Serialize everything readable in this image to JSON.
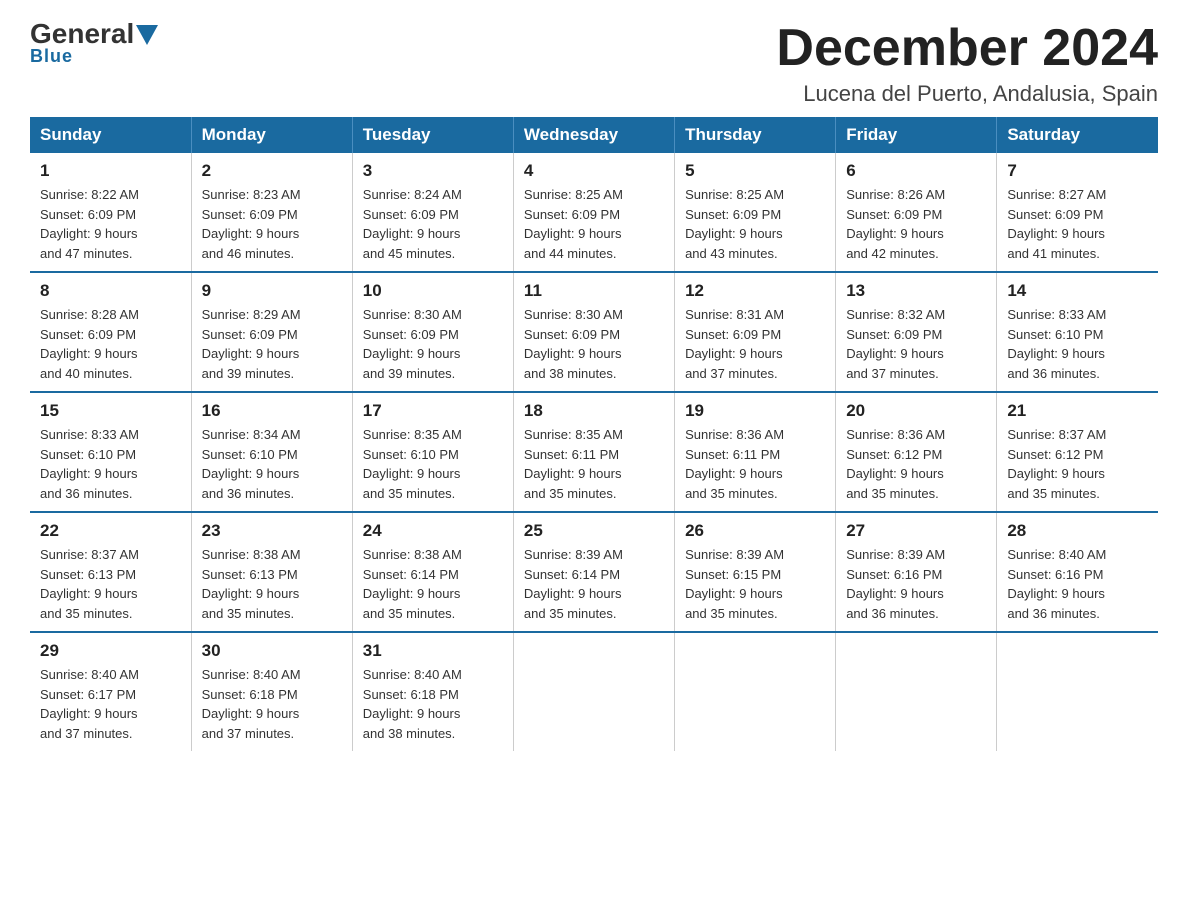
{
  "header": {
    "logo": {
      "general": "General",
      "blue": "Blue",
      "arrow_color": "#1a6aa0"
    },
    "title": "December 2024",
    "location": "Lucena del Puerto, Andalusia, Spain"
  },
  "days_of_week": [
    "Sunday",
    "Monday",
    "Tuesday",
    "Wednesday",
    "Thursday",
    "Friday",
    "Saturday"
  ],
  "weeks": [
    [
      {
        "num": "1",
        "sunrise": "8:22 AM",
        "sunset": "6:09 PM",
        "daylight": "9 hours and 47 minutes."
      },
      {
        "num": "2",
        "sunrise": "8:23 AM",
        "sunset": "6:09 PM",
        "daylight": "9 hours and 46 minutes."
      },
      {
        "num": "3",
        "sunrise": "8:24 AM",
        "sunset": "6:09 PM",
        "daylight": "9 hours and 45 minutes."
      },
      {
        "num": "4",
        "sunrise": "8:25 AM",
        "sunset": "6:09 PM",
        "daylight": "9 hours and 44 minutes."
      },
      {
        "num": "5",
        "sunrise": "8:25 AM",
        "sunset": "6:09 PM",
        "daylight": "9 hours and 43 minutes."
      },
      {
        "num": "6",
        "sunrise": "8:26 AM",
        "sunset": "6:09 PM",
        "daylight": "9 hours and 42 minutes."
      },
      {
        "num": "7",
        "sunrise": "8:27 AM",
        "sunset": "6:09 PM",
        "daylight": "9 hours and 41 minutes."
      }
    ],
    [
      {
        "num": "8",
        "sunrise": "8:28 AM",
        "sunset": "6:09 PM",
        "daylight": "9 hours and 40 minutes."
      },
      {
        "num": "9",
        "sunrise": "8:29 AM",
        "sunset": "6:09 PM",
        "daylight": "9 hours and 39 minutes."
      },
      {
        "num": "10",
        "sunrise": "8:30 AM",
        "sunset": "6:09 PM",
        "daylight": "9 hours and 39 minutes."
      },
      {
        "num": "11",
        "sunrise": "8:30 AM",
        "sunset": "6:09 PM",
        "daylight": "9 hours and 38 minutes."
      },
      {
        "num": "12",
        "sunrise": "8:31 AM",
        "sunset": "6:09 PM",
        "daylight": "9 hours and 37 minutes."
      },
      {
        "num": "13",
        "sunrise": "8:32 AM",
        "sunset": "6:09 PM",
        "daylight": "9 hours and 37 minutes."
      },
      {
        "num": "14",
        "sunrise": "8:33 AM",
        "sunset": "6:10 PM",
        "daylight": "9 hours and 36 minutes."
      }
    ],
    [
      {
        "num": "15",
        "sunrise": "8:33 AM",
        "sunset": "6:10 PM",
        "daylight": "9 hours and 36 minutes."
      },
      {
        "num": "16",
        "sunrise": "8:34 AM",
        "sunset": "6:10 PM",
        "daylight": "9 hours and 36 minutes."
      },
      {
        "num": "17",
        "sunrise": "8:35 AM",
        "sunset": "6:10 PM",
        "daylight": "9 hours and 35 minutes."
      },
      {
        "num": "18",
        "sunrise": "8:35 AM",
        "sunset": "6:11 PM",
        "daylight": "9 hours and 35 minutes."
      },
      {
        "num": "19",
        "sunrise": "8:36 AM",
        "sunset": "6:11 PM",
        "daylight": "9 hours and 35 minutes."
      },
      {
        "num": "20",
        "sunrise": "8:36 AM",
        "sunset": "6:12 PM",
        "daylight": "9 hours and 35 minutes."
      },
      {
        "num": "21",
        "sunrise": "8:37 AM",
        "sunset": "6:12 PM",
        "daylight": "9 hours and 35 minutes."
      }
    ],
    [
      {
        "num": "22",
        "sunrise": "8:37 AM",
        "sunset": "6:13 PM",
        "daylight": "9 hours and 35 minutes."
      },
      {
        "num": "23",
        "sunrise": "8:38 AM",
        "sunset": "6:13 PM",
        "daylight": "9 hours and 35 minutes."
      },
      {
        "num": "24",
        "sunrise": "8:38 AM",
        "sunset": "6:14 PM",
        "daylight": "9 hours and 35 minutes."
      },
      {
        "num": "25",
        "sunrise": "8:39 AM",
        "sunset": "6:14 PM",
        "daylight": "9 hours and 35 minutes."
      },
      {
        "num": "26",
        "sunrise": "8:39 AM",
        "sunset": "6:15 PM",
        "daylight": "9 hours and 35 minutes."
      },
      {
        "num": "27",
        "sunrise": "8:39 AM",
        "sunset": "6:16 PM",
        "daylight": "9 hours and 36 minutes."
      },
      {
        "num": "28",
        "sunrise": "8:40 AM",
        "sunset": "6:16 PM",
        "daylight": "9 hours and 36 minutes."
      }
    ],
    [
      {
        "num": "29",
        "sunrise": "8:40 AM",
        "sunset": "6:17 PM",
        "daylight": "9 hours and 37 minutes."
      },
      {
        "num": "30",
        "sunrise": "8:40 AM",
        "sunset": "6:18 PM",
        "daylight": "9 hours and 37 minutes."
      },
      {
        "num": "31",
        "sunrise": "8:40 AM",
        "sunset": "6:18 PM",
        "daylight": "9 hours and 38 minutes."
      },
      null,
      null,
      null,
      null
    ]
  ],
  "labels": {
    "sunrise": "Sunrise:",
    "sunset": "Sunset:",
    "daylight": "Daylight:"
  }
}
